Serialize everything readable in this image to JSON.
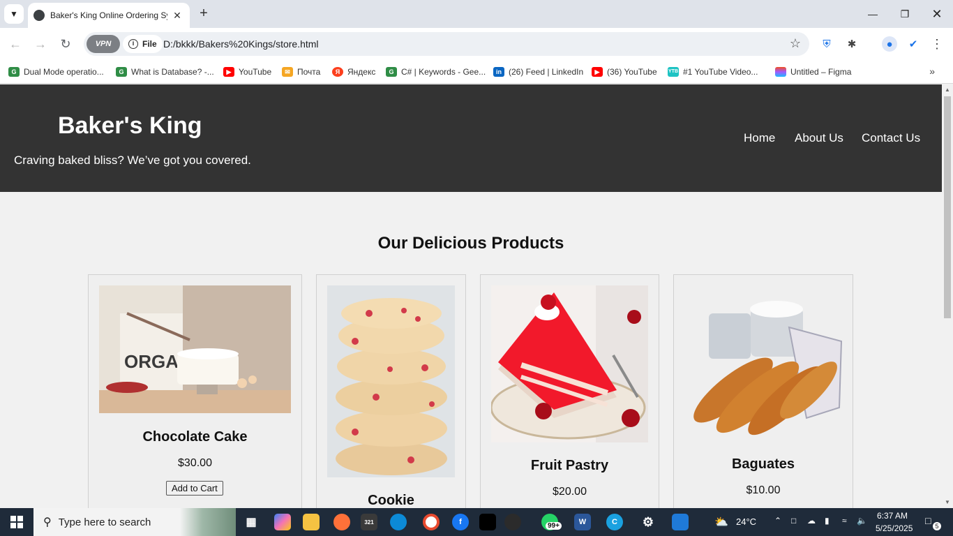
{
  "browser": {
    "tab_title": "Baker's King Online Ordering Sy",
    "address_chip": "File",
    "vpn_label": "VPN",
    "url": "D:/bkkk/Bakers%20Kings/store.html"
  },
  "bookmarks": [
    {
      "label": "Dual Mode operatio...",
      "icon": "gfg-icon",
      "color": "#2f8d46"
    },
    {
      "label": "What is Database? -...",
      "icon": "gfg-icon",
      "color": "#2f8d46"
    },
    {
      "label": "YouTube",
      "icon": "youtube-icon",
      "color": "#ff0000"
    },
    {
      "label": "Почта",
      "icon": "mail-icon",
      "color": "#f5a623"
    },
    {
      "label": "Яндекс",
      "icon": "yandex-icon",
      "color": "#fc3f1d"
    },
    {
      "label": "C# | Keywords - Gee...",
      "icon": "gfg-icon",
      "color": "#2f8d46"
    },
    {
      "label": "(26) Feed | LinkedIn",
      "icon": "linkedin-icon",
      "color": "#0a66c2"
    },
    {
      "label": "(36) YouTube",
      "icon": "youtube-icon",
      "color": "#ff0000"
    },
    {
      "label": "#1 YouTube Video...",
      "icon": "ytb-icon",
      "color": "#1ec3c3"
    },
    {
      "label": "Untitled – Figma",
      "icon": "figma-icon",
      "color": "#a259ff"
    }
  ],
  "site": {
    "title": "Baker's King",
    "tagline": "Craving baked bliss? We’ve got you covered.",
    "nav": [
      "Home",
      "About Us",
      "Contact Us"
    ],
    "section_title": "Our Delicious Products"
  },
  "products": [
    {
      "name": "Chocolate Cake",
      "price": "$30.00",
      "button": "Add to Cart",
      "image": "cake-photo"
    },
    {
      "name": "Cookie",
      "price": "",
      "button": "",
      "image": "cookie-photo"
    },
    {
      "name": "Fruit Pastry",
      "price": "$20.00",
      "button": "",
      "image": "pastry-photo"
    },
    {
      "name": "Baguates",
      "price": "$10.00",
      "button": "",
      "image": "baguette-photo"
    }
  ],
  "taskbar": {
    "search_placeholder": "Type here to search",
    "weather": "24°C",
    "time": "6:37 AM",
    "date": "5/25/2025",
    "notif_count": "5",
    "whatsapp_badge": "99+",
    "calendar_badge": "321"
  },
  "colors": {
    "header_bg": "#333333",
    "page_bg": "#f1f1f1",
    "taskbar_bg": "#1f2b3a"
  }
}
